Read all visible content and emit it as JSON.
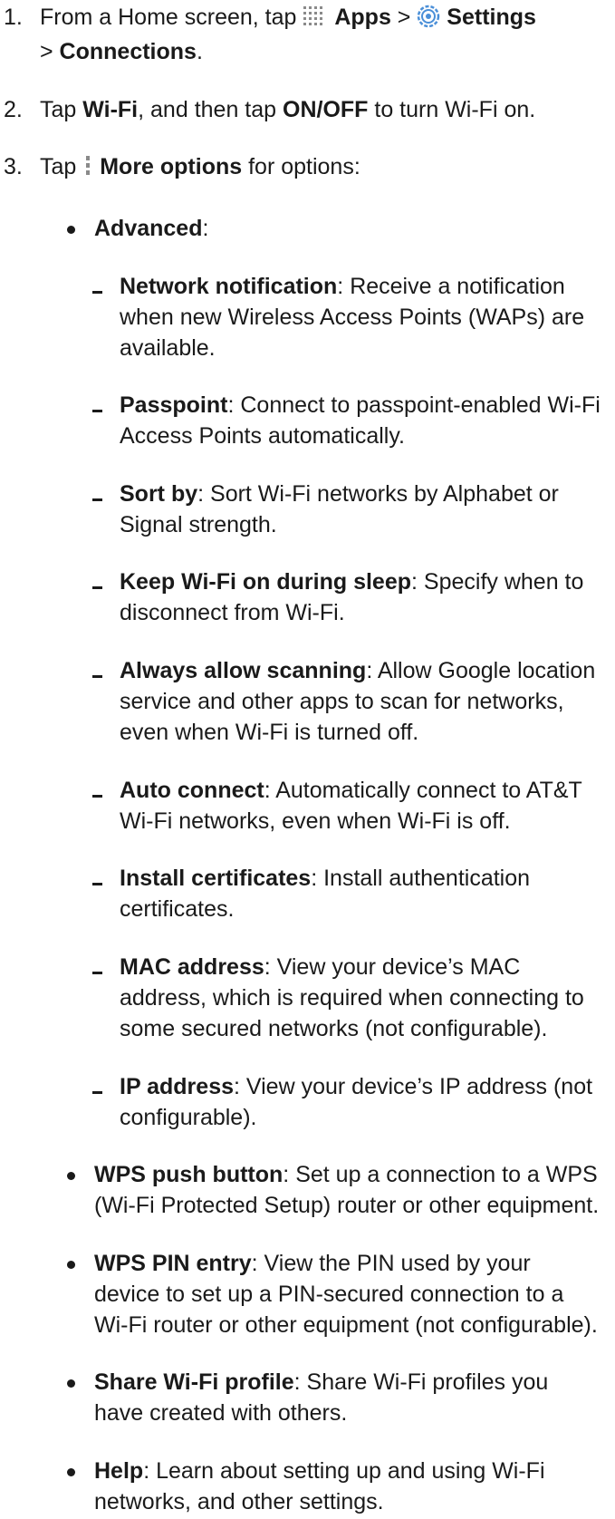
{
  "steps": [
    {
      "num": "1.",
      "t1": "From a Home screen, tap ",
      "apps": "Apps",
      "sep": " > ",
      "settings": "Settings",
      "t2": " > ",
      "connections": "Connections",
      "t3": "."
    },
    {
      "num": "2.",
      "t1": "Tap ",
      "wifi": "Wi-Fi",
      "t2": ", and then tap ",
      "onoff": "ON/OFF",
      "t3": " to turn Wi-Fi on."
    },
    {
      "num": "3.",
      "t1": "Tap ",
      "more": "More options",
      "t2": " for options:"
    }
  ],
  "advanced": {
    "label": "Advanced",
    "colon": ":"
  },
  "advanced_items": [
    {
      "term": "Network notification",
      "desc": ": Receive a notification when new Wireless Access Points (WAPs) are available."
    },
    {
      "term": "Passpoint",
      "desc": ": Connect to passpoint-enabled Wi-Fi Access Points automatically."
    },
    {
      "term": "Sort by",
      "desc": ": Sort Wi-Fi networks by Alphabet or Signal strength."
    },
    {
      "term": "Keep Wi-Fi on during sleep",
      "desc": ": Specify when to disconnect from Wi-Fi."
    },
    {
      "term": "Always allow scanning",
      "desc": ": Allow Google location service and other apps to scan for networks, even when Wi-Fi is turned off."
    },
    {
      "term": "Auto connect",
      "desc": ": Automatically connect to AT&T Wi-Fi networks, even when Wi-Fi is off."
    },
    {
      "term": "Install certificates",
      "desc": ": Install authentication certificates."
    },
    {
      "term": "MAC address",
      "desc": ": View your device’s MAC address, which is required when connecting to some secured networks (not configurable)."
    },
    {
      "term": "IP address",
      "desc": ": View your device’s IP address (not configurable)."
    }
  ],
  "options": [
    {
      "term": "WPS push button",
      "desc": ": Set up a connection to a WPS (Wi-Fi Protected Setup) router or other equipment."
    },
    {
      "term": "WPS PIN entry",
      "desc": ": View the PIN used by your device to set up a PIN-secured connection to a Wi-Fi router or other equipment (not configurable)."
    },
    {
      "term": "Share Wi-Fi profile",
      "desc": ": Share Wi-Fi profiles you have created with others."
    },
    {
      "term": "Help",
      "desc": ": Learn about setting up and using Wi-Fi networks, and other settings."
    }
  ],
  "icons": {
    "apps": "apps-grid-icon",
    "settings": "settings-gear-icon",
    "more": "more-options-icon"
  },
  "colors": {
    "text": "#1a1a1a",
    "settings_icon": "#4a8fd8"
  }
}
